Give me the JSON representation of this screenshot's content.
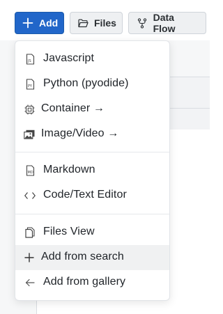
{
  "toolbar": {
    "add_label": "Add",
    "files_label": "Files",
    "dataflow_label": "Data Flow",
    "primary_color": "#2166c9"
  },
  "menu": {
    "groups": [
      [
        {
          "label": "Javascript",
          "icon": "js-file-icon"
        },
        {
          "label": "Python (pyodide)",
          "icon": "py-file-icon"
        },
        {
          "label": "Container →",
          "icon": "chip-icon"
        },
        {
          "label": "Image/Video →",
          "icon": "images-icon"
        }
      ],
      [
        {
          "label": "Markdown",
          "icon": "md-file-icon"
        },
        {
          "label": "Code/Text Editor",
          "icon": "code-brackets-icon"
        }
      ],
      [
        {
          "label": "Files View",
          "icon": "files-copy-icon"
        },
        {
          "label": "Add from search",
          "icon": "plus-icon",
          "highlighted": true
        },
        {
          "label": "Add from gallery",
          "icon": "arrow-left-icon"
        }
      ]
    ]
  }
}
